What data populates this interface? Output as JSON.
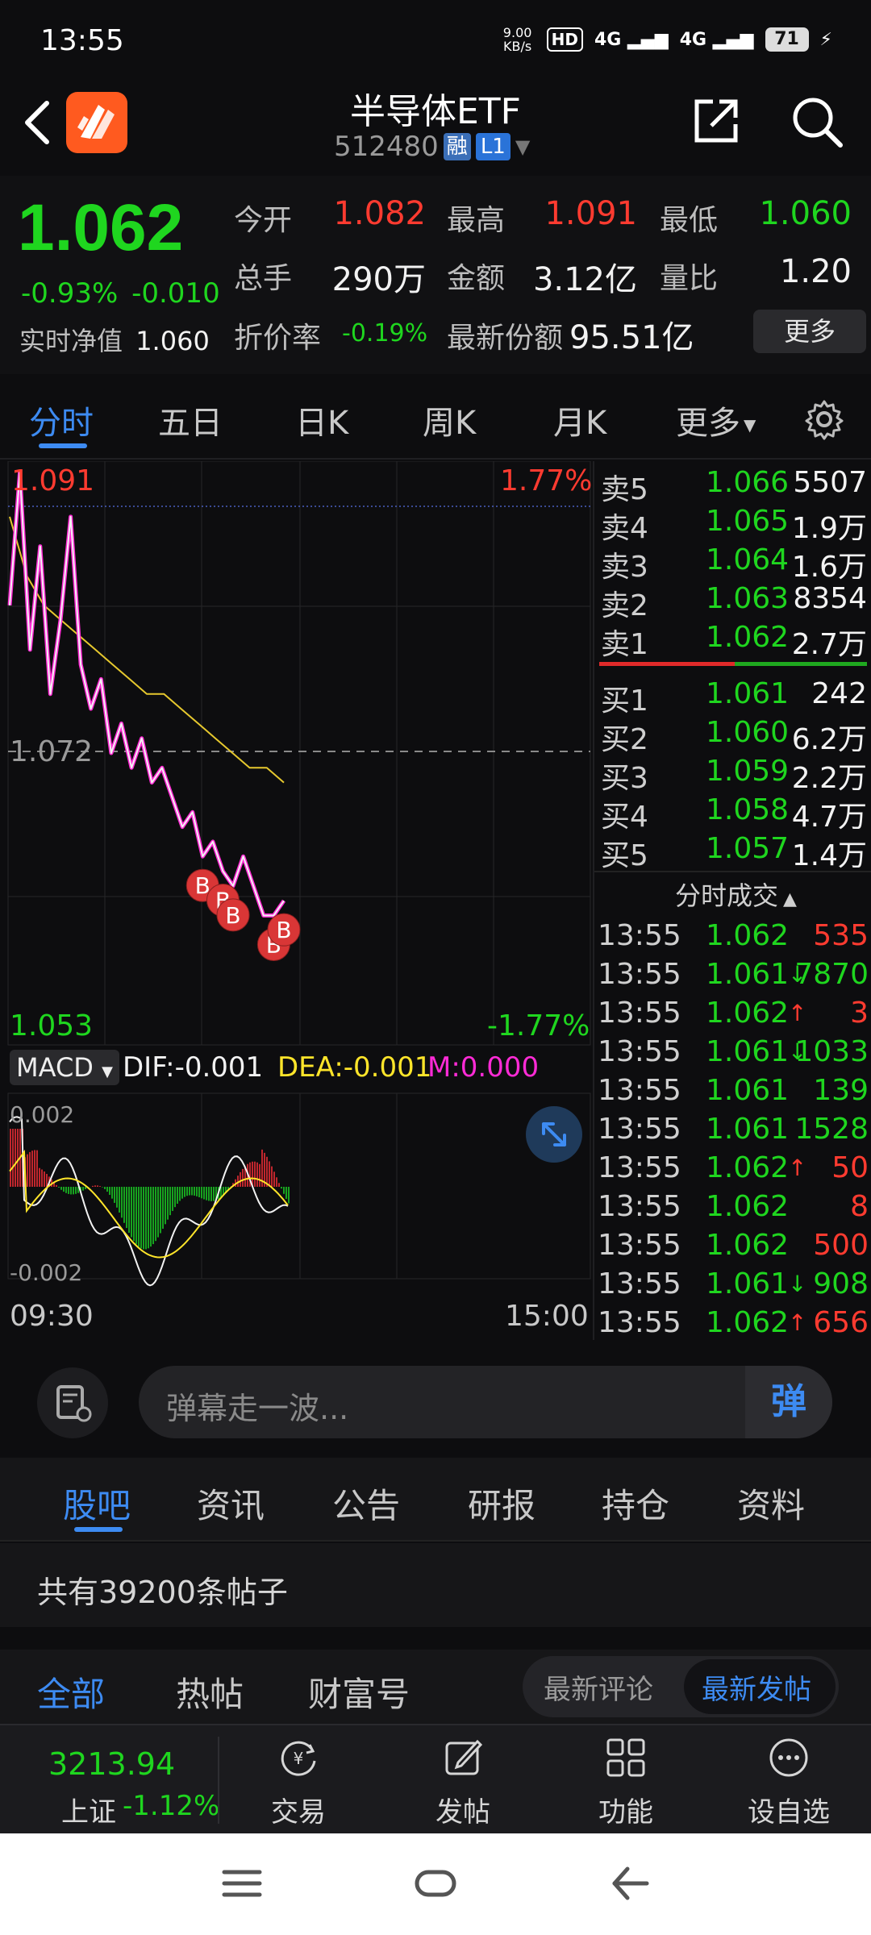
{
  "status_bar": {
    "time": "13:55",
    "net_speed": "9.00 KB/s",
    "hd": "HD",
    "sig1": "4G",
    "sig2": "4G",
    "battery": "71"
  },
  "header": {
    "title": "半导体ETF",
    "code": "512480",
    "tag_margin": "融",
    "tag_level": "L1"
  },
  "quote": {
    "price": "1.062",
    "change_pct": "-0.93%",
    "change": "-0.010",
    "nav_label": "实时净值",
    "nav_value": "1.060",
    "open_label": "今开",
    "open": "1.082",
    "high_label": "最高",
    "high": "1.091",
    "low_label": "最低",
    "low": "1.060",
    "volume_label": "总手",
    "volume": "290万",
    "amount_label": "金额",
    "amount": "3.12亿",
    "ratio_label": "量比",
    "ratio": "1.20",
    "discount_label": "折价率",
    "discount": "-0.19%",
    "shares_label": "最新份额",
    "shares": "95.51亿",
    "more_label": "更多"
  },
  "tabs": [
    "分时",
    "五日",
    "日K",
    "周K",
    "月K",
    "更多"
  ],
  "chart": {
    "max_price": "1.091",
    "max_pct": "1.77%",
    "prev_close": "1.072",
    "min_price": "1.053",
    "min_pct": "-1.77%",
    "macd_label": "MACD",
    "dif": "DIF:-0.001",
    "dea": "DEA:-0.001",
    "m": "M:0.000",
    "macd_top": "0.002",
    "macd_bottom": "-0.002",
    "time_start": "09:30",
    "time_end": "15:00",
    "b_marker": "B"
  },
  "chart_data": {
    "type": "line",
    "title": "",
    "ylim": [
      1.053,
      1.091
    ],
    "x_range": [
      "09:30",
      "15:00"
    ],
    "series": [
      {
        "name": "",
        "values": [
          1.082,
          1.091,
          1.079,
          1.086,
          1.076,
          1.081,
          1.088,
          1.078,
          1.075,
          1.077,
          1.072,
          1.074,
          1.071,
          1.073,
          1.07,
          1.071,
          1.069,
          1.067,
          1.068,
          1.065,
          1.066,
          1.064,
          1.063,
          1.065,
          1.063,
          1.061,
          1.061,
          1.062
        ]
      },
      {
        "name": "",
        "values": [
          1.088,
          1.084,
          1.082,
          1.081,
          1.08,
          1.079,
          1.078,
          1.077,
          1.076,
          1.076,
          1.075,
          1.074,
          1.073,
          1.072,
          1.071,
          1.071,
          1.07
        ]
      }
    ]
  },
  "orderbook": {
    "asks": [
      {
        "label": "卖5",
        "price": "1.066",
        "vol": "5507"
      },
      {
        "label": "卖4",
        "price": "1.065",
        "vol": "1.9万"
      },
      {
        "label": "卖3",
        "price": "1.064",
        "vol": "1.6万"
      },
      {
        "label": "卖2",
        "price": "1.063",
        "vol": "8354"
      },
      {
        "label": "卖1",
        "price": "1.062",
        "vol": "2.7万"
      }
    ],
    "bids": [
      {
        "label": "买1",
        "price": "1.061",
        "vol": "242"
      },
      {
        "label": "买2",
        "price": "1.060",
        "vol": "6.2万"
      },
      {
        "label": "买3",
        "price": "1.059",
        "vol": "2.2万"
      },
      {
        "label": "买4",
        "price": "1.058",
        "vol": "4.7万"
      },
      {
        "label": "买5",
        "price": "1.057",
        "vol": "1.4万"
      }
    ],
    "ticks_title": "分时成交",
    "ticks": [
      {
        "time": "13:55",
        "price": "1.062",
        "dir": "",
        "vol": "535",
        "color": "#ff3b30"
      },
      {
        "time": "13:55",
        "price": "1.061",
        "dir": "↓",
        "vol": "7870",
        "color": "#1fd61f"
      },
      {
        "time": "13:55",
        "price": "1.062",
        "dir": "↑",
        "vol": "3",
        "color": "#ff3b30"
      },
      {
        "time": "13:55",
        "price": "1.061",
        "dir": "↓",
        "vol": "1033",
        "color": "#1fd61f"
      },
      {
        "time": "13:55",
        "price": "1.061",
        "dir": "",
        "vol": "139",
        "color": "#1fd61f"
      },
      {
        "time": "13:55",
        "price": "1.061",
        "dir": "",
        "vol": "1528",
        "color": "#1fd61f"
      },
      {
        "time": "13:55",
        "price": "1.062",
        "dir": "↑",
        "vol": "50",
        "color": "#ff3b30"
      },
      {
        "time": "13:55",
        "price": "1.062",
        "dir": "",
        "vol": "8",
        "color": "#ff3b30"
      },
      {
        "time": "13:55",
        "price": "1.062",
        "dir": "",
        "vol": "500",
        "color": "#ff3b30"
      },
      {
        "time": "13:55",
        "price": "1.061",
        "dir": "↓",
        "vol": "908",
        "color": "#1fd61f"
      },
      {
        "time": "13:55",
        "price": "1.062",
        "dir": "↑",
        "vol": "656",
        "color": "#ff3b30"
      }
    ]
  },
  "danmu": {
    "placeholder": "弹幕走一波...",
    "button": "弹"
  },
  "subtabs": [
    "股吧",
    "资讯",
    "公告",
    "研报",
    "持仓",
    "资料"
  ],
  "post_count": "共有39200条帖子",
  "filter": {
    "tabs": [
      "全部",
      "热帖",
      "财富号"
    ],
    "seg": [
      "最新评论",
      "最新发帖"
    ]
  },
  "bottom": {
    "index_value": "3213.94",
    "index_name": "上证",
    "index_change": "-1.12%",
    "items": [
      "交易",
      "发帖",
      "功能",
      "设自选"
    ]
  },
  "colors": {
    "up": "#ff3b30",
    "down": "#1fd61f",
    "accent": "#3d8bf2"
  }
}
